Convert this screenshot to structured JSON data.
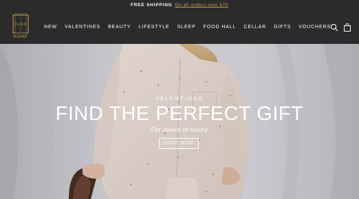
{
  "promo": {
    "bold": "FREE SHIPPING",
    "link": "On all orders over £70"
  },
  "brand": {
    "logo_text_top": "CLIFF",
    "logo_text_bottom": "HOME",
    "accent": "#c9a24a"
  },
  "nav": {
    "items": [
      "NEW",
      "VALENTINES",
      "BEAUTY",
      "LIFESTYLE",
      "SLEEP",
      "FOOD HALL",
      "CELLAR",
      "GIFTS",
      "VOUCHERS"
    ]
  },
  "icons": {
    "search": "search-icon",
    "bag": "shopping-bag-icon"
  },
  "hero": {
    "kicker": "VALENTINES",
    "title": "FIND THE PERFECT GIFT",
    "subtitle": "For lovers of luxury",
    "button": "SHOP NOW"
  }
}
